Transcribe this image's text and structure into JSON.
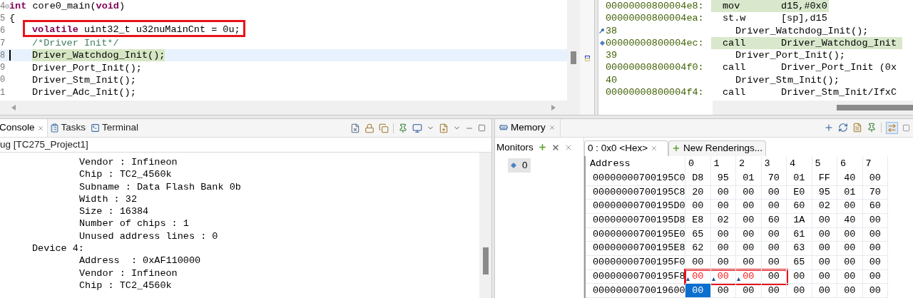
{
  "editor": {
    "lines": [
      {
        "number": "4",
        "fold": true,
        "indent": false,
        "current": false,
        "boxed": false,
        "tokens": [
          {
            "kind": "keyword",
            "text": "int"
          },
          {
            "kind": "plain",
            "text": " core0_main("
          },
          {
            "kind": "keyword",
            "text": "void"
          },
          {
            "kind": "plain",
            "text": ")"
          }
        ]
      },
      {
        "number": "5",
        "fold": false,
        "indent": false,
        "current": false,
        "boxed": false,
        "tokens": [
          {
            "kind": "plain",
            "text": "{"
          }
        ]
      },
      {
        "number": "6",
        "fold": false,
        "indent": true,
        "current": false,
        "boxed": true,
        "tokens": [
          {
            "kind": "keyword",
            "text": "volatile"
          },
          {
            "kind": "plain",
            "text": " uint32_t u32nuMainCnt = 0u;"
          }
        ]
      },
      {
        "number": "7",
        "fold": false,
        "indent": true,
        "current": false,
        "boxed": false,
        "tokens": [
          {
            "kind": "comment",
            "text": "/*Driver Init*/"
          }
        ]
      },
      {
        "number": "8",
        "fold": false,
        "indent": true,
        "current": true,
        "boxed": false,
        "tokens": [
          {
            "kind": "plain",
            "text": "Driver_Watchdog_Init();"
          }
        ]
      },
      {
        "number": "9",
        "fold": false,
        "indent": true,
        "current": false,
        "boxed": false,
        "tokens": [
          {
            "kind": "plain",
            "text": "Driver_Port_Init();"
          }
        ]
      },
      {
        "number": "0",
        "fold": false,
        "indent": true,
        "current": false,
        "boxed": false,
        "tokens": [
          {
            "kind": "plain",
            "text": "Driver_Stm_Init();"
          }
        ]
      },
      {
        "number": "1",
        "fold": false,
        "indent": true,
        "current": false,
        "boxed": false,
        "tokens": [
          {
            "kind": "plain",
            "text": "Driver_Adc_Init();"
          }
        ]
      }
    ]
  },
  "disassembly": {
    "rows": [
      {
        "kind": "asm",
        "address": "00000000800004e8:",
        "mnemonic": "mov",
        "operands": "d15,#0x0",
        "highlighted": true,
        "bookmark": false,
        "pointer": false
      },
      {
        "kind": "asm",
        "address": "00000000800004ea:",
        "mnemonic": "st.w",
        "operands": "[sp],d15",
        "highlighted": false,
        "bookmark": false,
        "pointer": false
      },
      {
        "kind": "source",
        "line": "38",
        "code": "Driver_Watchdog_Init();",
        "bookmark": true,
        "pointer": false
      },
      {
        "kind": "asm",
        "address": "00000000800004ec:",
        "mnemonic": "call",
        "operands": "Driver_Watchdog_Init",
        "highlighted": true,
        "bookmark": false,
        "pointer": true
      },
      {
        "kind": "source",
        "line": "39",
        "code": "Driver_Port_Init();",
        "bookmark": false,
        "pointer": false
      },
      {
        "kind": "asm",
        "address": "00000000800004f0:",
        "mnemonic": "call",
        "operands": "Driver_Port_Init (0x",
        "highlighted": false,
        "bookmark": false,
        "pointer": false
      },
      {
        "kind": "source",
        "line": "40",
        "code": "Driver_Stm_Init();",
        "bookmark": false,
        "pointer": false
      },
      {
        "kind": "asm",
        "address": "00000000800004f4:",
        "mnemonic": "call",
        "operands": "Driver_Stm_Init/IfxC",
        "highlighted": false,
        "bookmark": false,
        "pointer": false
      }
    ]
  },
  "console": {
    "tabs": [
      {
        "label": "Console",
        "selected": true
      },
      {
        "label": "Tasks",
        "selected": false
      },
      {
        "label": "Terminal",
        "selected": false
      }
    ],
    "title": "ug [TC275_Project1]",
    "blocks": [
      {
        "lines": [
          "Vendor : Infineon",
          "Chip : TC2_4560k",
          "Subname : Data Flash Bank 0b",
          "Width : 32",
          "Size : 16384",
          "Number of chips : 1",
          "Unused address lines : 0"
        ]
      },
      {
        "heading": "Device 4:",
        "lines": [
          "Address  : 0xAF110000",
          "Vendor : Infineon",
          "Chip : TC2_4560k"
        ]
      }
    ]
  },
  "memory": {
    "tab": "Memory",
    "monitors": {
      "title": "Monitors",
      "items": [
        {
          "label": "0",
          "selected": true
        }
      ]
    },
    "renderings": [
      {
        "label": "0 : 0x0 <Hex>",
        "selected": true
      },
      {
        "label": "New Renderings...",
        "selected": false
      }
    ],
    "columns": [
      "Address",
      "0",
      "1",
      "2",
      "3",
      "4",
      "5",
      "6",
      "7"
    ],
    "rows": [
      {
        "address": "00000000700195C0",
        "boxed": false,
        "cells": [
          {
            "value": "D8",
            "changed": false,
            "selected": false
          },
          {
            "value": "95",
            "changed": false,
            "selected": false
          },
          {
            "value": "01",
            "changed": false,
            "selected": false
          },
          {
            "value": "70",
            "changed": false,
            "selected": false
          },
          {
            "value": "01",
            "changed": false,
            "selected": false
          },
          {
            "value": "FF",
            "changed": false,
            "selected": false
          },
          {
            "value": "40",
            "changed": false,
            "selected": false
          },
          {
            "value": "00",
            "changed": false,
            "selected": false
          }
        ]
      },
      {
        "address": "00000000700195C8",
        "boxed": false,
        "cells": [
          {
            "value": "20",
            "changed": false,
            "selected": false
          },
          {
            "value": "00",
            "changed": false,
            "selected": false
          },
          {
            "value": "00",
            "changed": false,
            "selected": false
          },
          {
            "value": "00",
            "changed": false,
            "selected": false
          },
          {
            "value": "E0",
            "changed": false,
            "selected": false
          },
          {
            "value": "95",
            "changed": false,
            "selected": false
          },
          {
            "value": "01",
            "changed": false,
            "selected": false
          },
          {
            "value": "70",
            "changed": false,
            "selected": false
          }
        ]
      },
      {
        "address": "00000000700195D0",
        "boxed": false,
        "cells": [
          {
            "value": "00",
            "changed": false,
            "selected": false
          },
          {
            "value": "00",
            "changed": false,
            "selected": false
          },
          {
            "value": "00",
            "changed": false,
            "selected": false
          },
          {
            "value": "00",
            "changed": false,
            "selected": false
          },
          {
            "value": "60",
            "changed": false,
            "selected": false
          },
          {
            "value": "02",
            "changed": false,
            "selected": false
          },
          {
            "value": "00",
            "changed": false,
            "selected": false
          },
          {
            "value": "60",
            "changed": false,
            "selected": false
          }
        ]
      },
      {
        "address": "00000000700195D8",
        "boxed": false,
        "cells": [
          {
            "value": "E8",
            "changed": false,
            "selected": false
          },
          {
            "value": "02",
            "changed": false,
            "selected": false
          },
          {
            "value": "00",
            "changed": false,
            "selected": false
          },
          {
            "value": "60",
            "changed": false,
            "selected": false
          },
          {
            "value": "1A",
            "changed": false,
            "selected": false
          },
          {
            "value": "00",
            "changed": false,
            "selected": false
          },
          {
            "value": "40",
            "changed": false,
            "selected": false
          },
          {
            "value": "00",
            "changed": false,
            "selected": false
          }
        ]
      },
      {
        "address": "00000000700195E0",
        "boxed": false,
        "cells": [
          {
            "value": "65",
            "changed": false,
            "selected": false
          },
          {
            "value": "00",
            "changed": false,
            "selected": false
          },
          {
            "value": "00",
            "changed": false,
            "selected": false
          },
          {
            "value": "00",
            "changed": false,
            "selected": false
          },
          {
            "value": "61",
            "changed": false,
            "selected": false
          },
          {
            "value": "00",
            "changed": false,
            "selected": false
          },
          {
            "value": "00",
            "changed": false,
            "selected": false
          },
          {
            "value": "00",
            "changed": false,
            "selected": false
          }
        ]
      },
      {
        "address": "00000000700195E8",
        "boxed": false,
        "cells": [
          {
            "value": "62",
            "changed": false,
            "selected": false
          },
          {
            "value": "00",
            "changed": false,
            "selected": false
          },
          {
            "value": "00",
            "changed": false,
            "selected": false
          },
          {
            "value": "00",
            "changed": false,
            "selected": false
          },
          {
            "value": "63",
            "changed": false,
            "selected": false
          },
          {
            "value": "00",
            "changed": false,
            "selected": false
          },
          {
            "value": "00",
            "changed": false,
            "selected": false
          },
          {
            "value": "00",
            "changed": false,
            "selected": false
          }
        ]
      },
      {
        "address": "00000000700195F0",
        "boxed": false,
        "cells": [
          {
            "value": "00",
            "changed": false,
            "selected": false
          },
          {
            "value": "00",
            "changed": false,
            "selected": false
          },
          {
            "value": "00",
            "changed": false,
            "selected": false
          },
          {
            "value": "00",
            "changed": false,
            "selected": false
          },
          {
            "value": "65",
            "changed": false,
            "selected": false
          },
          {
            "value": "00",
            "changed": false,
            "selected": false
          },
          {
            "value": "00",
            "changed": false,
            "selected": false
          },
          {
            "value": "00",
            "changed": false,
            "selected": false
          }
        ]
      },
      {
        "address": "00000000700195F8",
        "boxed": true,
        "cells": [
          {
            "value": "00",
            "changed": true,
            "selected": false
          },
          {
            "value": "00",
            "changed": true,
            "selected": false
          },
          {
            "value": "00",
            "changed": true,
            "selected": false
          },
          {
            "value": "00",
            "changed": false,
            "selected": false
          },
          {
            "value": "00",
            "changed": false,
            "selected": false
          },
          {
            "value": "00",
            "changed": false,
            "selected": false
          },
          {
            "value": "00",
            "changed": false,
            "selected": false
          },
          {
            "value": "00",
            "changed": false,
            "selected": false
          }
        ]
      },
      {
        "address": "0000000070019600",
        "boxed": false,
        "cells": [
          {
            "value": "00",
            "changed": false,
            "selected": true
          },
          {
            "value": "00",
            "changed": false,
            "selected": false
          },
          {
            "value": "00",
            "changed": false,
            "selected": false
          },
          {
            "value": "00",
            "changed": false,
            "selected": false
          },
          {
            "value": "00",
            "changed": false,
            "selected": false
          },
          {
            "value": "00",
            "changed": false,
            "selected": false
          },
          {
            "value": "00",
            "changed": false,
            "selected": false
          },
          {
            "value": "00",
            "changed": false,
            "selected": false
          }
        ]
      }
    ]
  }
}
